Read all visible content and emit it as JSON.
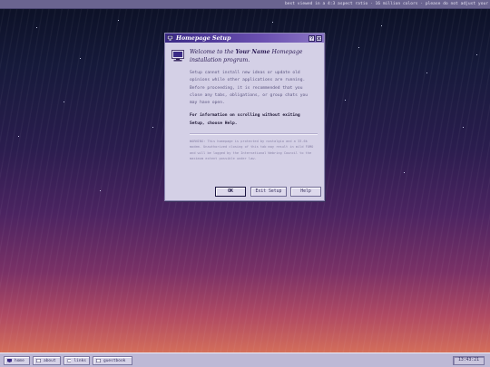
{
  "banner": {
    "text": "best viewed in a 4:3 aspect ratio · 16 million colors · please do not adjust your"
  },
  "dialog": {
    "title": "Homepage Setup",
    "title_buttons": [
      "help",
      "close"
    ],
    "welcome_prefix": "Welcome to the ",
    "welcome_name": "Your Name",
    "welcome_suffix": " Homepage installation program.",
    "paragraph": "Setup cannot install new ideas or update old opinions while other applications are running. Before proceeding, it is recommended that you close any tabs, obligations, or group chats you may have open.",
    "paragraph_bold": "For information on scrolling without exiting Setup, choose Help.",
    "warning": "WARNING: This homepage is protected by nostalgia and a 33.6k modem. Unauthorized closing of this tab may result in mild FOMO and will be logged by the International Webring Council to the maximum extent possible under law.",
    "buttons": {
      "ok": "OK",
      "exit": "Exit Setup",
      "help": "Help"
    }
  },
  "taskbar": {
    "items": [
      {
        "label": "home",
        "icon": "monitor-icon"
      },
      {
        "label": "about",
        "icon": "document-icon"
      },
      {
        "label": "links",
        "icon": "folder-icon"
      },
      {
        "label": "guestbook",
        "icon": "document-icon"
      }
    ],
    "clock": "13:43:21"
  },
  "colors": {
    "titlebar": "#3b2a86",
    "dialog_bg": "#d4d0e6",
    "taskbar_bg": "#bdb9d6",
    "sky_top": "#0b1024",
    "horizon": "#e0835a"
  }
}
